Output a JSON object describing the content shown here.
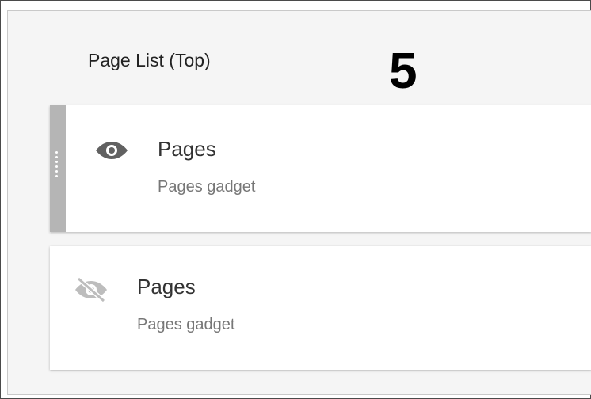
{
  "section": {
    "title": "Page List (Top)"
  },
  "step_number": "5",
  "gadgets": [
    {
      "title": "Pages",
      "subtitle": "Pages gadget",
      "visibility_icon": "eye-icon",
      "state": "visible"
    },
    {
      "title": "Pages",
      "subtitle": "Pages gadget",
      "visibility_icon": "eye-off-icon",
      "state": "hidden"
    }
  ],
  "colors": {
    "panel_bg": "#f5f5f5",
    "card_bg": "#ffffff",
    "handle": "#b5b5b5",
    "icon_visible": "#616161",
    "icon_hidden": "#bdbdbd"
  }
}
